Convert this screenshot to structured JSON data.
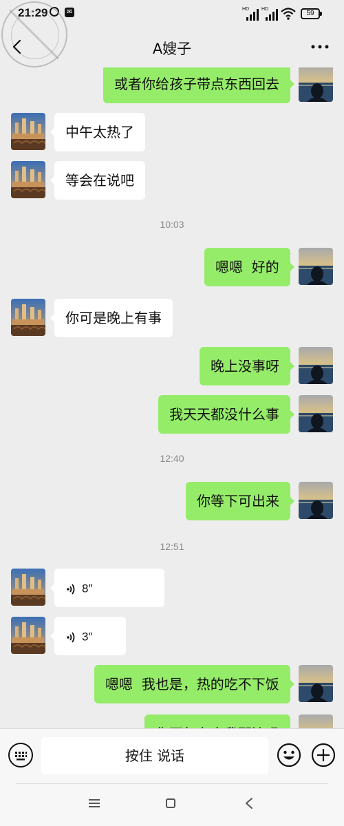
{
  "status_bar": {
    "time": "21:29",
    "network_label": "HD",
    "battery": "59"
  },
  "header": {
    "title": "A嫂子"
  },
  "messages": [
    {
      "kind": "text",
      "from": "me",
      "text": "或者你给孩子带点东西回去"
    },
    {
      "kind": "text",
      "from": "them",
      "text": "中午太热了"
    },
    {
      "kind": "text",
      "from": "them",
      "text": "等会在说吧"
    },
    {
      "kind": "time",
      "text": "10:03"
    },
    {
      "kind": "text",
      "from": "me",
      "text": "嗯嗯  好的"
    },
    {
      "kind": "text",
      "from": "them",
      "text": "你可是晚上有事"
    },
    {
      "kind": "text",
      "from": "me",
      "text": "晚上没事呀"
    },
    {
      "kind": "text",
      "from": "me",
      "text": "我天天都没什么事"
    },
    {
      "kind": "time",
      "text": "12:40"
    },
    {
      "kind": "text",
      "from": "me",
      "text": "你等下可出来"
    },
    {
      "kind": "time",
      "text": "12:51"
    },
    {
      "kind": "voice",
      "from": "them",
      "duration": "8″"
    },
    {
      "kind": "voice",
      "from": "them",
      "duration": "3″"
    },
    {
      "kind": "text",
      "from": "me",
      "text": "嗯嗯  我也是，热的吃不下饭"
    },
    {
      "kind": "text",
      "from": "me",
      "text": "你下午有空我那边吗"
    }
  ],
  "input_bar": {
    "hold_to_talk": "按住 说话"
  },
  "colors": {
    "background": "#ededed",
    "outgoing_bubble": "#95ec69",
    "incoming_bubble": "#ffffff"
  },
  "icons": {
    "back": "chevron-left-icon",
    "more": "more-dots-icon",
    "keyboard": "keyboard-icon",
    "emoji": "emoji-icon",
    "plus": "plus-icon",
    "voice": "voice-wave-icon"
  }
}
